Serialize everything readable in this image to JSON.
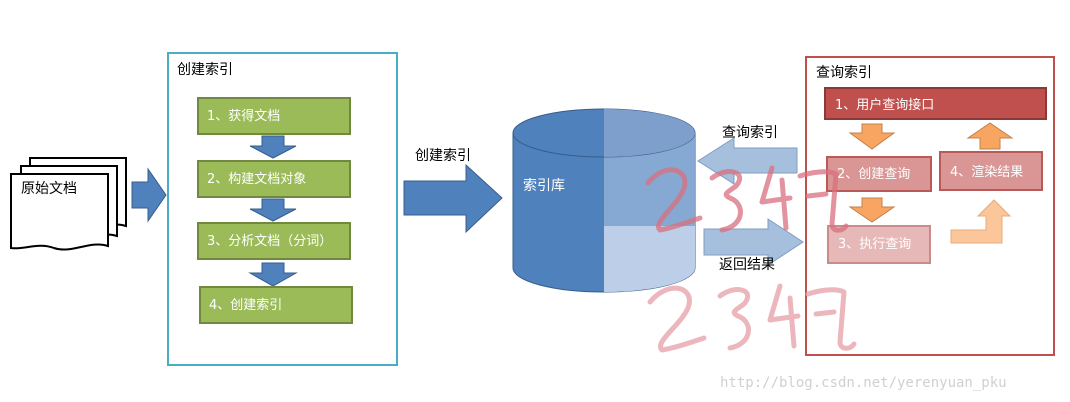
{
  "source_document": {
    "label": "原始文档"
  },
  "create_index_panel": {
    "title": "创建索引",
    "steps": [
      {
        "label": "1、获得文档"
      },
      {
        "label": "2、构建文档对象"
      },
      {
        "label": "3、分析文档（分词）"
      },
      {
        "label": "4、创建索引"
      }
    ]
  },
  "create_index_arrow": {
    "label": "创建索引"
  },
  "index_db": {
    "label": "索引库"
  },
  "query_arrow": {
    "label": "查询索引"
  },
  "result_arrow": {
    "label": "返回结果"
  },
  "query_panel": {
    "title": "查询索引",
    "interface": "1、用户查询接口",
    "create_query": "2、创建查询",
    "execute_query": "3、执行查询",
    "render_results": "4、渲染结果"
  },
  "watermark": {
    "handwritten": "234飞",
    "url": "http://blog.csdn.net/yerenyuan_pku"
  },
  "colors": {
    "step_green": "#9bbb59",
    "step_green_border": "#71893f",
    "blue_arrow": "#4f81bd",
    "create_panel_border": "#4bacc6",
    "query_panel_border": "#c0504d",
    "red_box": "#c0504d",
    "orange_arrow": "#f79646",
    "db_blue": "#4f81bd"
  }
}
